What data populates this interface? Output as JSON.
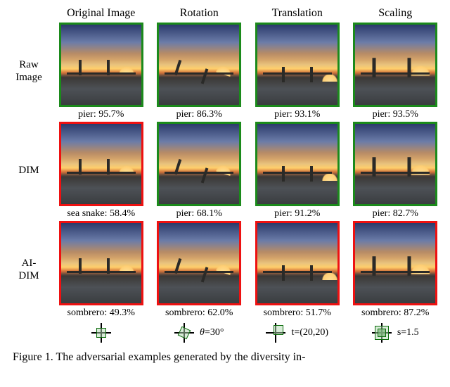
{
  "columns": [
    "Original Image",
    "Rotation",
    "Translation",
    "Scaling"
  ],
  "rows": [
    {
      "label_line1": "Raw",
      "label_line2": "Image"
    },
    {
      "label_line1": "DIM",
      "label_line2": ""
    },
    {
      "label_line1": "AI-",
      "label_line2": "DIM"
    }
  ],
  "cells": [
    [
      {
        "label": "pier",
        "conf": "95.7%",
        "border": "green",
        "variant": "orig"
      },
      {
        "label": "pier",
        "conf": "86.3%",
        "border": "green",
        "variant": "rot"
      },
      {
        "label": "pier",
        "conf": "93.1%",
        "border": "green",
        "variant": "trans"
      },
      {
        "label": "pier",
        "conf": "93.5%",
        "border": "green",
        "variant": "scale"
      }
    ],
    [
      {
        "label": "sea snake",
        "conf": "58.4%",
        "border": "red",
        "variant": "orig"
      },
      {
        "label": "pier",
        "conf": "68.1%",
        "border": "green",
        "variant": "rot"
      },
      {
        "label": "pier",
        "conf": "91.2%",
        "border": "green",
        "variant": "trans"
      },
      {
        "label": "pier",
        "conf": "82.7%",
        "border": "green",
        "variant": "scale"
      }
    ],
    [
      {
        "label": "sombrero",
        "conf": "49.3%",
        "border": "red",
        "variant": "orig"
      },
      {
        "label": "sombrero",
        "conf": "62.0%",
        "border": "red",
        "variant": "rot"
      },
      {
        "label": "sombrero",
        "conf": "51.7%",
        "border": "red",
        "variant": "trans"
      },
      {
        "label": "sombrero",
        "conf": "87.2%",
        "border": "red",
        "variant": "scale"
      }
    ]
  ],
  "params": {
    "rotation": {
      "text": "θ=30°"
    },
    "translation": {
      "text": "t=(20,20)"
    },
    "scaling": {
      "text": "s=1.5"
    }
  },
  "figure_caption": "Figure 1. The adversarial examples generated by the diversity in-"
}
